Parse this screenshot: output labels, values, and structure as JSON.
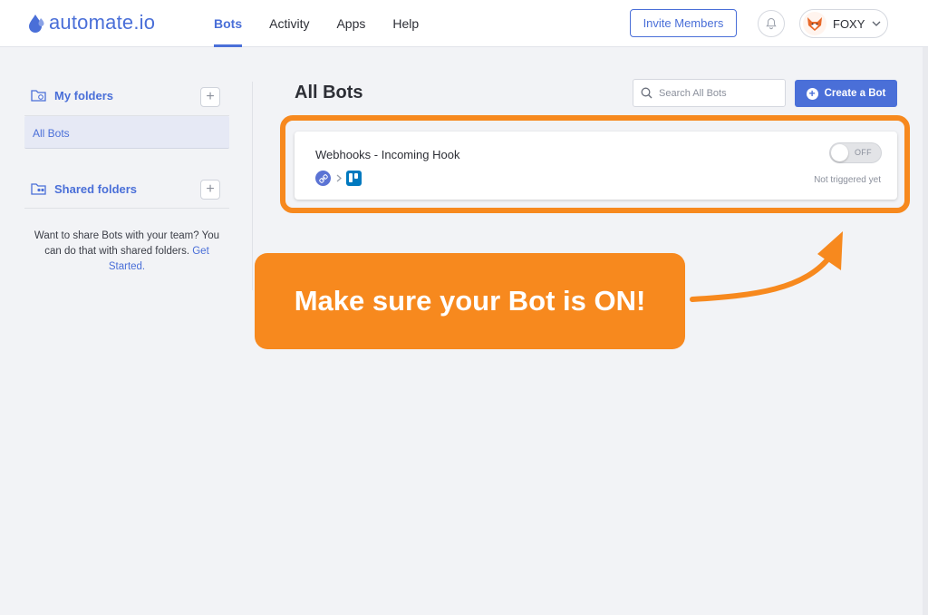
{
  "header": {
    "logo_text": "automate.io",
    "nav": [
      {
        "label": "Bots",
        "active": true
      },
      {
        "label": "Activity",
        "active": false
      },
      {
        "label": "Apps",
        "active": false
      },
      {
        "label": "Help",
        "active": false
      }
    ],
    "invite_label": "Invite Members",
    "user_name": "FOXY"
  },
  "sidebar": {
    "my_folders_label": "My folders",
    "all_bots_label": "All Bots",
    "shared_folders_label": "Shared folders",
    "share_text": "Want to share Bots with your team? You can do that with shared folders.",
    "share_link": "Get Started."
  },
  "main": {
    "title": "All Bots",
    "search_placeholder": "Search All Bots",
    "create_label": "Create a Bot",
    "bot": {
      "name": "Webhooks - Incoming Hook",
      "toggle_label": "OFF",
      "status": "Not triggered yet"
    }
  },
  "callout": {
    "text": "Make sure your Bot is ON!"
  },
  "colors": {
    "accent": "#4a6fd8",
    "callout": "#f7891e"
  }
}
